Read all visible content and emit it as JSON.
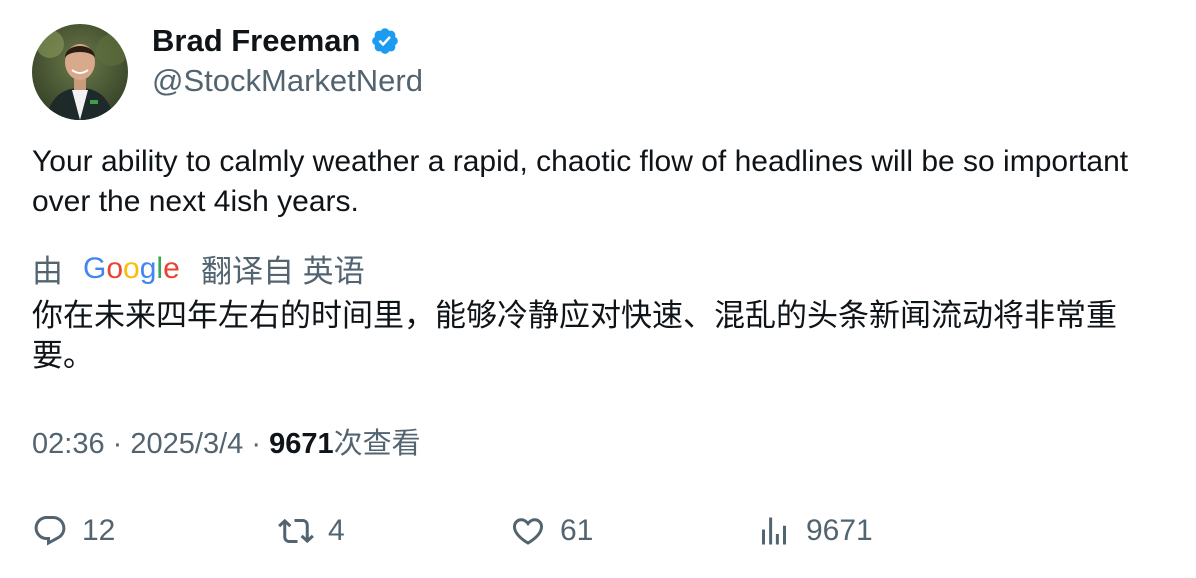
{
  "author": {
    "name": "Brad Freeman",
    "handle": "@StockMarketNerd",
    "verified": true
  },
  "tweet": {
    "text": "Your ability to calmly weather a rapid, chaotic flow of headlines will be so important over the next 4ish years."
  },
  "translation": {
    "prefix": "由",
    "provider": "Google",
    "suffix": "翻译自 英语",
    "text": "你在未来四年左右的时间里，能够冷静应对快速、混乱的头条新闻流动将非常重要。"
  },
  "meta": {
    "time": "02:36",
    "date": "2025/3/4",
    "views_count": "9671",
    "views_label": "次查看",
    "separator": "·"
  },
  "actions": {
    "replies": "12",
    "retweets": "4",
    "likes": "61",
    "views": "9671"
  },
  "colors": {
    "text": "#0f1419",
    "secondary": "#536471",
    "verified": "#1d9bf0"
  },
  "icons": [
    "verified-badge-icon",
    "google-logo",
    "reply-icon",
    "retweet-icon",
    "like-icon",
    "views-icon"
  ]
}
